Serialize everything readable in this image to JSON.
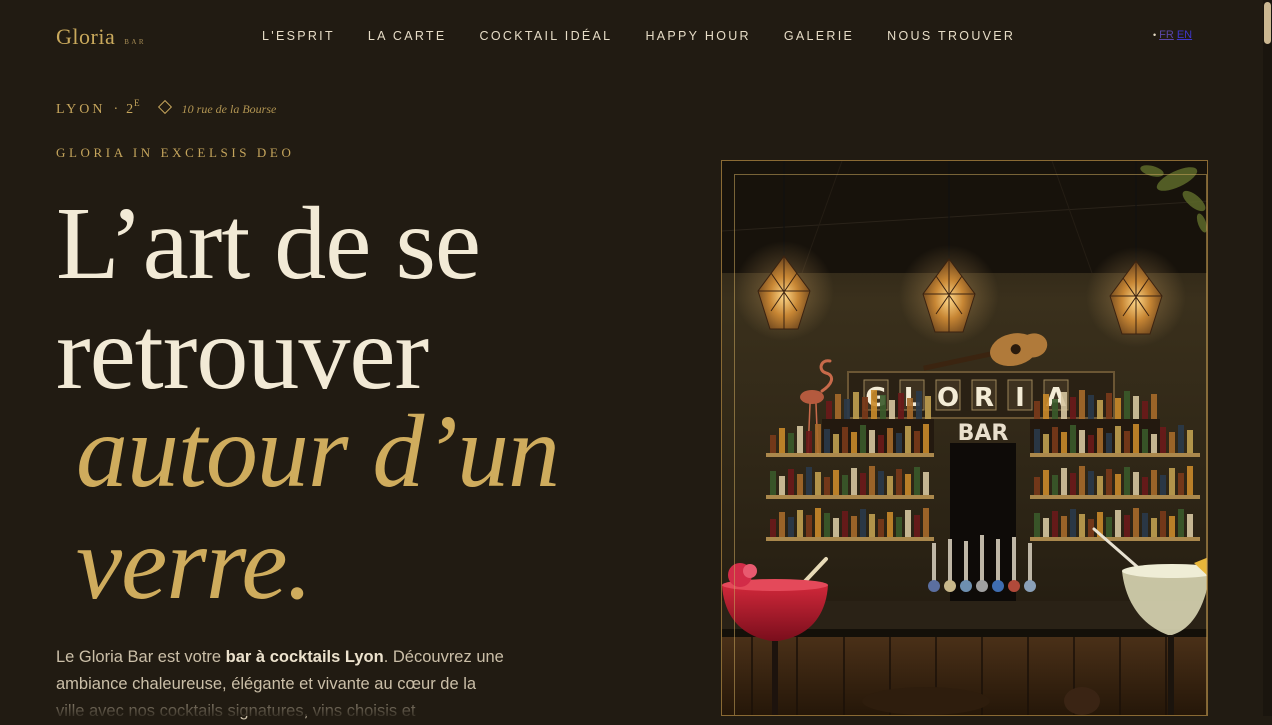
{
  "brand": {
    "name": "Gloria",
    "sub": "BAR"
  },
  "nav": [
    {
      "label": "L'ESPRIT"
    },
    {
      "label": "LA CARTE"
    },
    {
      "label": "COCKTAIL IDÉAL"
    },
    {
      "label": "HAPPY HOUR"
    },
    {
      "label": "GALERIE"
    },
    {
      "label": "NOUS TROUVER"
    }
  ],
  "lang": {
    "fr": "FR",
    "en": "EN"
  },
  "hero": {
    "city": "LYON",
    "separator": "·",
    "arrondissement": "2",
    "arrondissement_suffix": "E",
    "address": "10 rue de la Bourse",
    "motto": "GLORIA IN EXCELSIS DEO",
    "headline_line1": "L’art de se",
    "headline_line2": "retrouver",
    "headline_accent1": "autour d’un",
    "headline_accent2": "verre.",
    "intro_part1": "Le Gloria Bar est votre ",
    "intro_strong": "bar à cocktails Lyon",
    "intro_part2": ". Découvrez une ambiance chaleureuse, élégante et vivante au cœur de la ville avec nos cocktails signatures, vins choisis et"
  },
  "photo": {
    "sign_text": "GLORIA",
    "sign_sub": "BAR"
  },
  "colors": {
    "background": "#211b12",
    "gold": "#c5a55c",
    "cream": "#f2ead6"
  }
}
